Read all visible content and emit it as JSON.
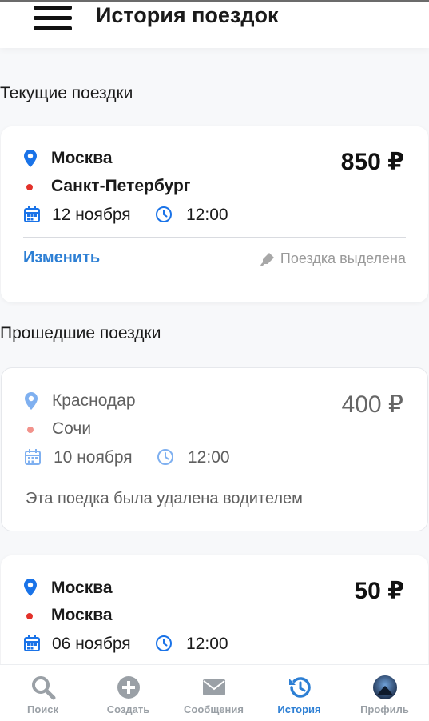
{
  "header": {
    "title": "История поездок"
  },
  "sections": {
    "current": "Текущие поездки",
    "past": "Прошедшие поездки"
  },
  "current_trip": {
    "from": "Москва",
    "to": "Санкт-Петербург",
    "date": "12 ноября",
    "time": "12:00",
    "price": "850 ₽",
    "edit_label": "Изменить",
    "status_label": "Поездка выделена"
  },
  "past_trips": [
    {
      "from": "Краснодар",
      "to": "Сочи",
      "date": "10 ноября",
      "time": "12:00",
      "price": "400 ₽",
      "note": "Эта поедка была удалена водителем"
    },
    {
      "from": "Москва",
      "to": "Москва",
      "date": "06 ноября",
      "time": "12:00",
      "price": "50 ₽"
    }
  ],
  "bottom_nav": [
    {
      "label": "Поиск",
      "icon": "search-icon"
    },
    {
      "label": "Создать",
      "icon": "plus-circle-icon"
    },
    {
      "label": "Сообщения",
      "icon": "envelope-icon"
    },
    {
      "label": "История",
      "icon": "history-icon",
      "active": true
    },
    {
      "label": "Профиль",
      "icon": "avatar-icon"
    }
  ],
  "colors": {
    "accent": "#2d7fd4",
    "pin": "#1a73e8",
    "destination_dot": "#e3312a",
    "inactive_nav": "#9aa0a6"
  }
}
